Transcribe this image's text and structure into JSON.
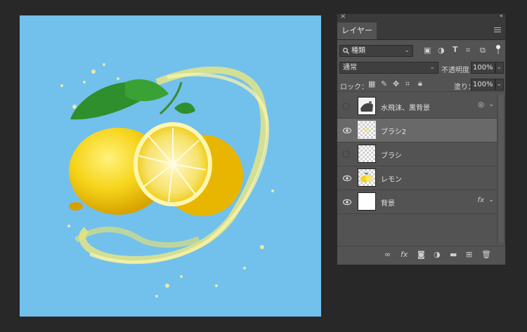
{
  "panel": {
    "close": "×",
    "collapse": "‹‹",
    "tab_label": "レイヤー",
    "menu_icon": "hamburger-icon"
  },
  "filter": {
    "search_icon": "search-icon",
    "kind_value": "種類",
    "icons": [
      "image-filter-icon",
      "adjustment-filter-icon",
      "type-filter-icon",
      "shape-filter-icon",
      "smart-object-filter-icon",
      "filter-toggle-icon"
    ]
  },
  "blend": {
    "mode_value": "通常",
    "opacity_label": "不透明度：",
    "opacity_value": "100%"
  },
  "lock": {
    "label": "ロック：",
    "icons": [
      "lock-transparent-icon",
      "lock-paint-icon",
      "lock-position-icon",
      "lock-artboard-icon",
      "lock-all-icon"
    ],
    "fill_label": "塗り：",
    "fill_value": "100%"
  },
  "layers": [
    {
      "name": "水飛沫、黒背景",
      "visible": false,
      "selected": false,
      "thumb": "splash",
      "badge": "◎"
    },
    {
      "name": "ブラシ2",
      "visible": true,
      "selected": true,
      "thumb": "checker-yellow",
      "badge": ""
    },
    {
      "name": "ブラシ",
      "visible": false,
      "selected": false,
      "thumb": "checker",
      "badge": ""
    },
    {
      "name": "レモン",
      "visible": true,
      "selected": false,
      "thumb": "lemon",
      "badge": ""
    },
    {
      "name": "背景",
      "visible": true,
      "selected": false,
      "thumb": "white",
      "badge": "fx"
    }
  ],
  "bottom_icons": [
    "link-icon",
    "fx-icon",
    "mask-icon",
    "adjustment-icon",
    "folder-icon",
    "new-layer-icon",
    "trash-icon"
  ],
  "bottom_fx": "fx",
  "colors": {
    "canvas_bg": "#72c0ec",
    "panel_bg": "#535353",
    "selected_row": "#696969",
    "workspace": "#282828"
  }
}
